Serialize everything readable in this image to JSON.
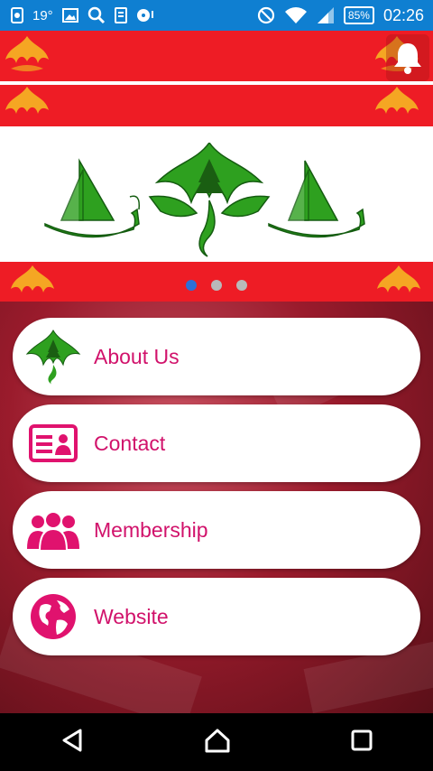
{
  "status_bar": {
    "temperature": "19°",
    "battery": "85%",
    "time": "02:26",
    "left_icons": [
      "screen-record-icon",
      "image-icon",
      "search-icon",
      "document-icon",
      "media-icon"
    ],
    "right_icons": [
      "do-not-disturb-icon",
      "wifi-icon",
      "signal-icon"
    ]
  },
  "banner": {
    "carousel_pages": 3,
    "active_page": 1,
    "colors": {
      "red": "#ee1c25",
      "flame": "#f5a623",
      "emblem": "#2ea01f"
    }
  },
  "menu": {
    "items": [
      {
        "label": "About Us",
        "icon": "emblem-icon"
      },
      {
        "label": "Contact",
        "icon": "contact-card-icon"
      },
      {
        "label": "Membership",
        "icon": "people-icon"
      },
      {
        "label": "Website",
        "icon": "globe-icon"
      }
    ],
    "label_color": "#d1126b"
  },
  "nav_bar": {
    "icons": [
      "back-icon",
      "home-icon",
      "recents-icon"
    ]
  }
}
